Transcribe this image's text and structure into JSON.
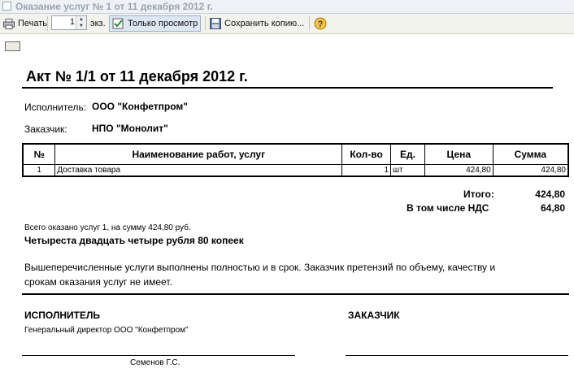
{
  "window": {
    "title": "Оказание услуг № 1 от 11 декабря 2012 г."
  },
  "toolbar": {
    "print_label": "Печать",
    "copies_value": "1",
    "copies_unit": "экз.",
    "view_only_label": "Только просмотр",
    "save_copy_label": "Сохранить копию..."
  },
  "act": {
    "title": "Акт № 1/1 от 11 декабря 2012 г.",
    "executor_label": "Исполнитель:",
    "executor_name": "ООО \"Конфетпром\"",
    "customer_label": "Заказчик:",
    "customer_name": "НПО \"Монолит\""
  },
  "table": {
    "columns": [
      "№",
      "Наименование работ, услуг",
      "Кол-во",
      "Ед.",
      "Цена",
      "Сумма"
    ],
    "rows": [
      {
        "num": "1",
        "name": "Доставка товара",
        "qty": "1",
        "unit": "шт",
        "price": "424,80",
        "sum": "424,80"
      }
    ]
  },
  "totals": {
    "total_label": "Итого:",
    "total_value": "424,80",
    "vat_label": "В том числе НДС",
    "vat_value": "64,80"
  },
  "summary": {
    "line": "Всего оказано услуг 1, на сумму 424,80 руб.",
    "amount_words": "Четыреста двадцать четыре рубля 80 копеек",
    "statement_line1": "Вышеперечисленные услуги выполнены полностью и в срок. Заказчик претензий по объему, качеству и",
    "statement_line2": "срокам оказания услуг не имеет."
  },
  "signatures": {
    "executor_heading": "ИСПОЛНИТЕЛЬ",
    "executor_position": "Генеральный директор ООО \"Конфетпром\"",
    "executor_signer": "Семенов Г.С.",
    "customer_heading": "ЗАКАЗЧИК"
  }
}
